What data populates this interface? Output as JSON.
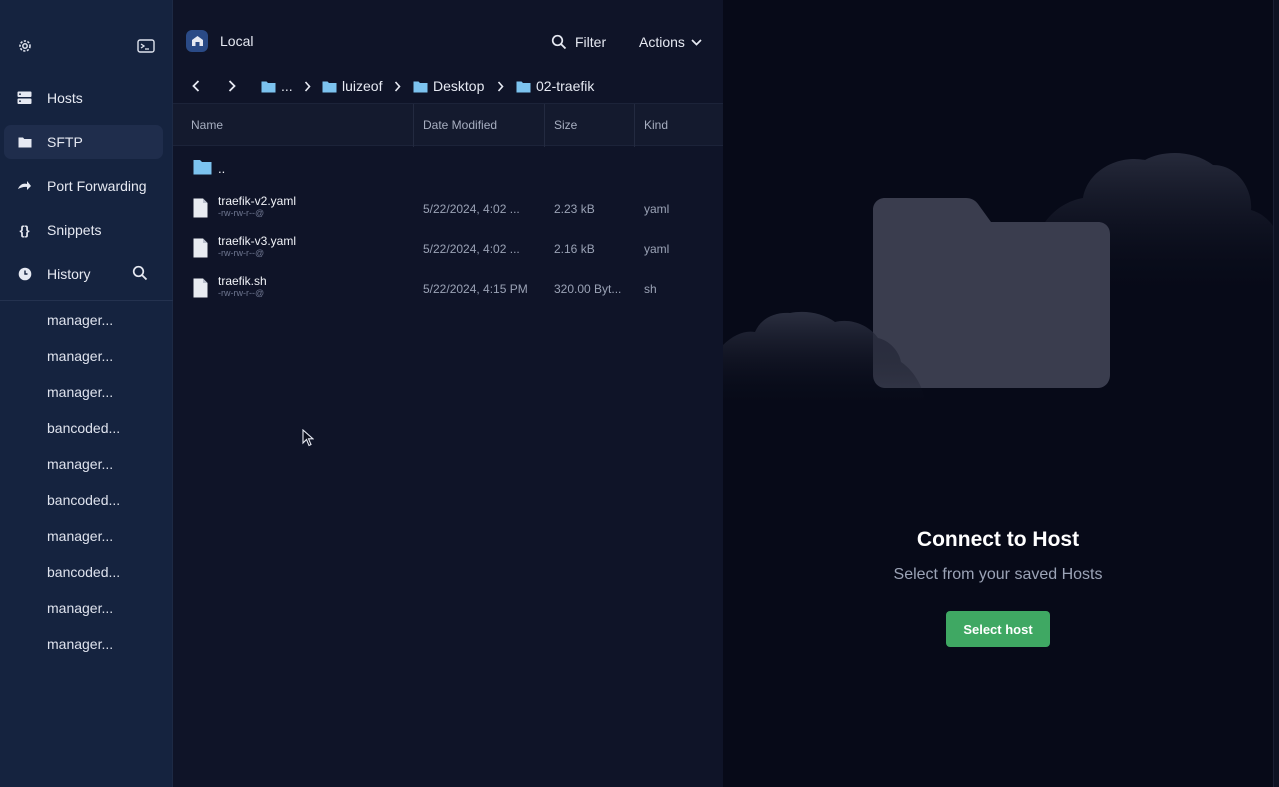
{
  "sidebar": {
    "nav": [
      {
        "label": "Hosts",
        "icon": "hosts-icon",
        "active": false
      },
      {
        "label": "SFTP",
        "icon": "folder-icon",
        "active": true
      },
      {
        "label": "Port Forwarding",
        "icon": "port-forwarding-icon",
        "active": false
      },
      {
        "label": "Snippets",
        "icon": "braces-icon",
        "active": false
      },
      {
        "label": "History",
        "icon": "clock-icon",
        "active": false
      }
    ],
    "history": [
      "manager...",
      "manager...",
      "manager...",
      "bancoded...",
      "manager...",
      "bancoded...",
      "manager...",
      "bancoded...",
      "manager...",
      "manager..."
    ]
  },
  "local_panel": {
    "title": "Local",
    "filter_label": "Filter",
    "actions_label": "Actions",
    "breadcrumb": [
      "...",
      "luizeof",
      "Desktop",
      "02-traefik"
    ],
    "columns": [
      "Name",
      "Date Modified",
      "Size",
      "Kind"
    ],
    "parent_label": "..",
    "files": [
      {
        "name": "traefik-v2.yaml",
        "perms": "-rw-rw-r--@",
        "date": "5/22/2024, 4:02 ...",
        "size": "2.23 kB",
        "kind": "yaml"
      },
      {
        "name": "traefik-v3.yaml",
        "perms": "-rw-rw-r--@",
        "date": "5/22/2024, 4:02 ...",
        "size": "2.16 kB",
        "kind": "yaml"
      },
      {
        "name": "traefik.sh",
        "perms": "-rw-rw-r--@",
        "date": "5/22/2024, 4:15 PM",
        "size": "320.00 Byt...",
        "kind": "sh"
      }
    ]
  },
  "remote_panel": {
    "title": "Connect to Host",
    "subtitle": "Select from your saved Hosts",
    "button_label": "Select host"
  },
  "colors": {
    "sidebar_bg": "#15233f",
    "panel_bg": "#0f1428",
    "accent_green": "#3fa863",
    "folder_blue": "#7cc3ef"
  }
}
